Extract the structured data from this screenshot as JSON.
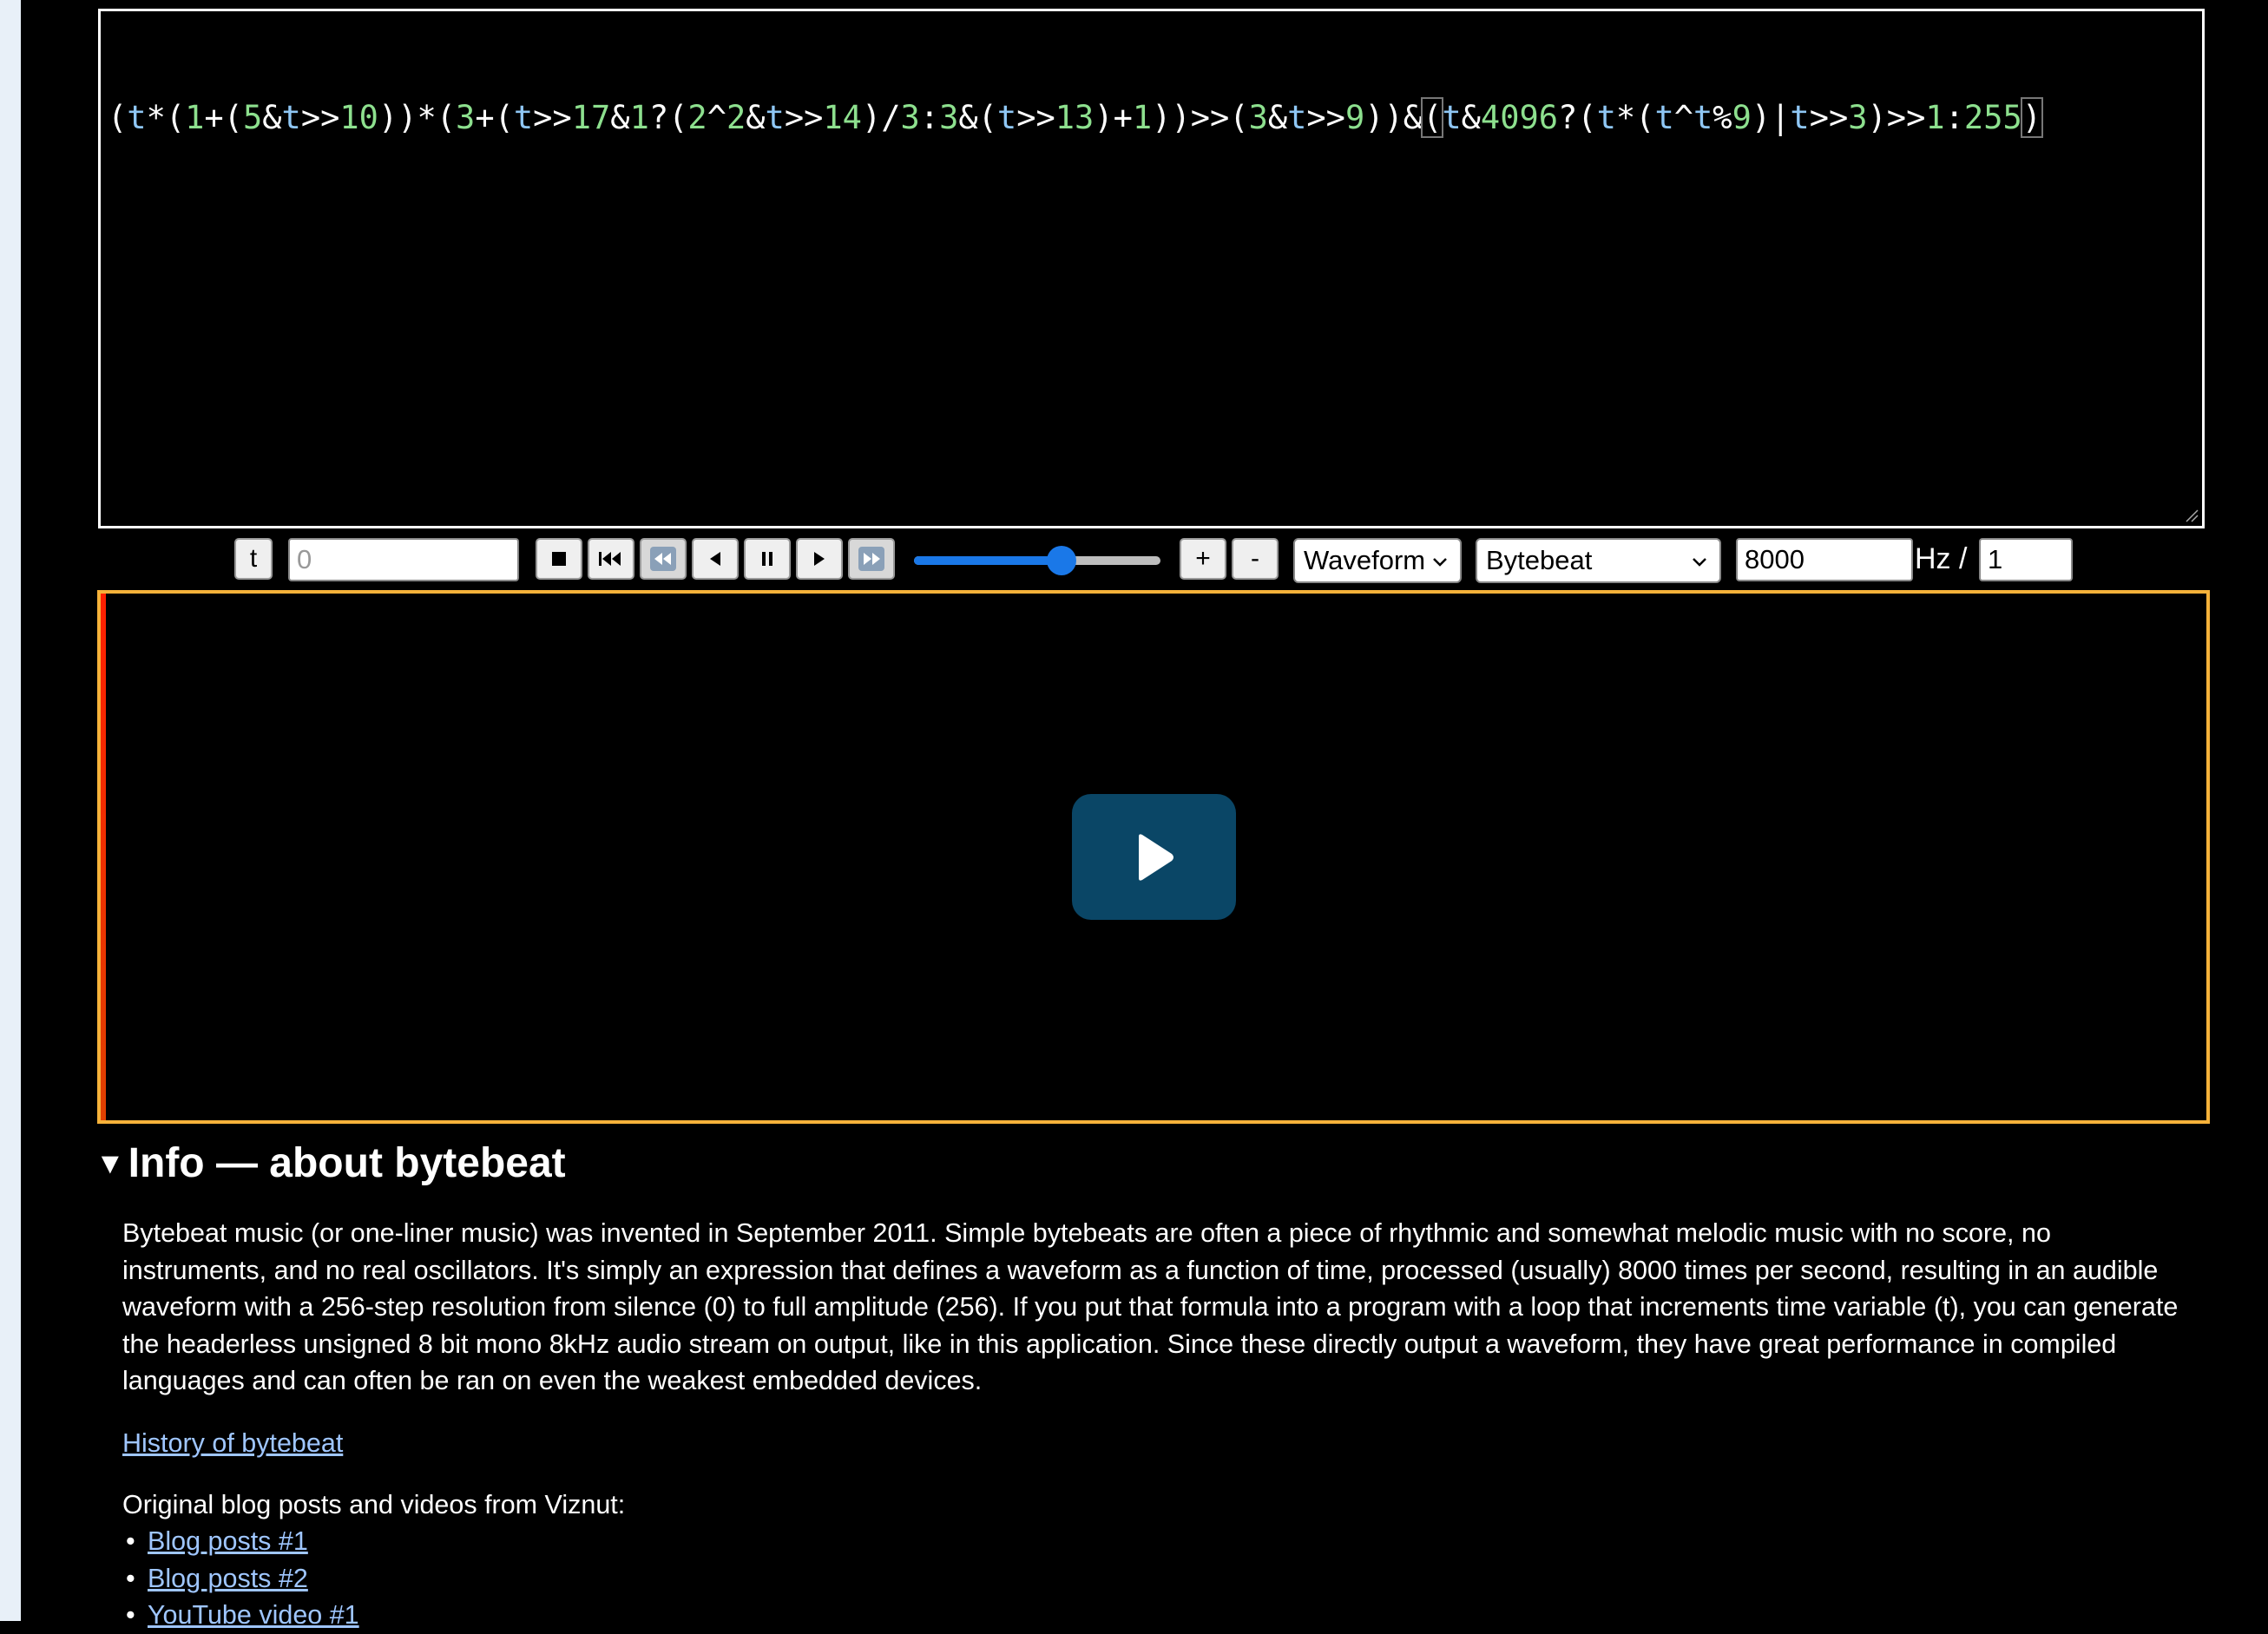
{
  "editor": {
    "code_tokens": [
      {
        "t": "(",
        "c": "op"
      },
      {
        "t": "t",
        "c": "v"
      },
      {
        "t": "*(",
        "c": "op"
      },
      {
        "t": "1",
        "c": "n"
      },
      {
        "t": "+(",
        "c": "op"
      },
      {
        "t": "5",
        "c": "n"
      },
      {
        "t": "&",
        "c": "op"
      },
      {
        "t": "t",
        "c": "v"
      },
      {
        "t": ">>",
        "c": "op"
      },
      {
        "t": "10",
        "c": "n"
      },
      {
        "t": "))*(",
        "c": "op"
      },
      {
        "t": "3",
        "c": "n"
      },
      {
        "t": "+(",
        "c": "op"
      },
      {
        "t": "t",
        "c": "v"
      },
      {
        "t": ">>",
        "c": "op"
      },
      {
        "t": "17",
        "c": "n"
      },
      {
        "t": "&",
        "c": "op"
      },
      {
        "t": "1",
        "c": "n"
      },
      {
        "t": "?(",
        "c": "op"
      },
      {
        "t": "2",
        "c": "n"
      },
      {
        "t": "^",
        "c": "op"
      },
      {
        "t": "2",
        "c": "n"
      },
      {
        "t": "&",
        "c": "op"
      },
      {
        "t": "t",
        "c": "v"
      },
      {
        "t": ">>",
        "c": "op"
      },
      {
        "t": "14",
        "c": "n"
      },
      {
        "t": ")/",
        "c": "op"
      },
      {
        "t": "3",
        "c": "n"
      },
      {
        "t": ":",
        "c": "op"
      },
      {
        "t": "3",
        "c": "n"
      },
      {
        "t": "&(",
        "c": "op"
      },
      {
        "t": "t",
        "c": "v"
      },
      {
        "t": ">>",
        "c": "op"
      },
      {
        "t": "13",
        "c": "n"
      },
      {
        "t": ")+",
        "c": "op"
      },
      {
        "t": "1",
        "c": "n"
      },
      {
        "t": "))>>(",
        "c": "op"
      },
      {
        "t": "3",
        "c": "n"
      },
      {
        "t": "&",
        "c": "op"
      },
      {
        "t": "t",
        "c": "v"
      },
      {
        "t": ">>",
        "c": "op"
      },
      {
        "t": "9",
        "c": "n"
      },
      {
        "t": "))&",
        "c": "op"
      },
      {
        "t": "(",
        "c": "op",
        "hl": true
      },
      {
        "t": "t",
        "c": "v"
      },
      {
        "t": "&",
        "c": "op"
      },
      {
        "t": "4096",
        "c": "n"
      },
      {
        "t": "?(",
        "c": "op"
      },
      {
        "t": "t",
        "c": "v"
      },
      {
        "t": "*(",
        "c": "op"
      },
      {
        "t": "t",
        "c": "v"
      },
      {
        "t": "^",
        "c": "op"
      },
      {
        "t": "t",
        "c": "v"
      },
      {
        "t": "%",
        "c": "op"
      },
      {
        "t": "9",
        "c": "n"
      },
      {
        "t": ")|",
        "c": "op"
      },
      {
        "t": "t",
        "c": "v"
      },
      {
        "t": ">>",
        "c": "op"
      },
      {
        "t": "3",
        "c": "n"
      },
      {
        "t": ")>>",
        "c": "op"
      },
      {
        "t": "1",
        "c": "n"
      },
      {
        "t": ":",
        "c": "op"
      },
      {
        "t": "255",
        "c": "n"
      },
      {
        "t": ")",
        "c": "op",
        "hl": true
      }
    ]
  },
  "controls": {
    "t_label": "t",
    "time_placeholder": "0",
    "icons": {
      "stop": "stop-icon",
      "restart": "skip-to-start-icon",
      "rewind": "fast-rewind-icon",
      "reverse": "play-reverse-icon",
      "pause": "pause-icon",
      "play": "play-icon",
      "forward": "fast-forward-icon"
    },
    "volume_fraction": 0.6,
    "zoom_in_label": "+",
    "zoom_out_label": "-",
    "draw_mode": "Waveform",
    "audio_mode": "Bytebeat",
    "sample_rate": "8000",
    "hz_label": "Hz /",
    "divisor": "1"
  },
  "canvas": {
    "overlay_icon": "play-icon",
    "overlay_color": "#0a4666",
    "border_color": "#f6b23a"
  },
  "info": {
    "title": "Info — about bytebeat",
    "description": "Bytebeat music (or one-liner music) was invented in September 2011. Simple bytebeats are often a piece of rhythmic and somewhat melodic music with no score, no instruments, and no real oscillators. It's simply an expression that defines a waveform as a function of time, processed (usually) 8000 times per second, resulting in an audible waveform with a 256-step resolution from silence (0) to full amplitude (256). If you put that formula into a program with a loop that increments time variable (t), you can generate the headerless unsigned 8 bit mono 8kHz audio stream on output, like in this application. Since these directly output a waveform, they have great performance in compiled languages and can often be ran on even the weakest embedded devices.",
    "history_link": "History of bytebeat",
    "original_label": "Original blog posts and videos from Viznut:",
    "links": [
      "Blog posts #1",
      "Blog posts #2",
      "YouTube video #1"
    ]
  }
}
